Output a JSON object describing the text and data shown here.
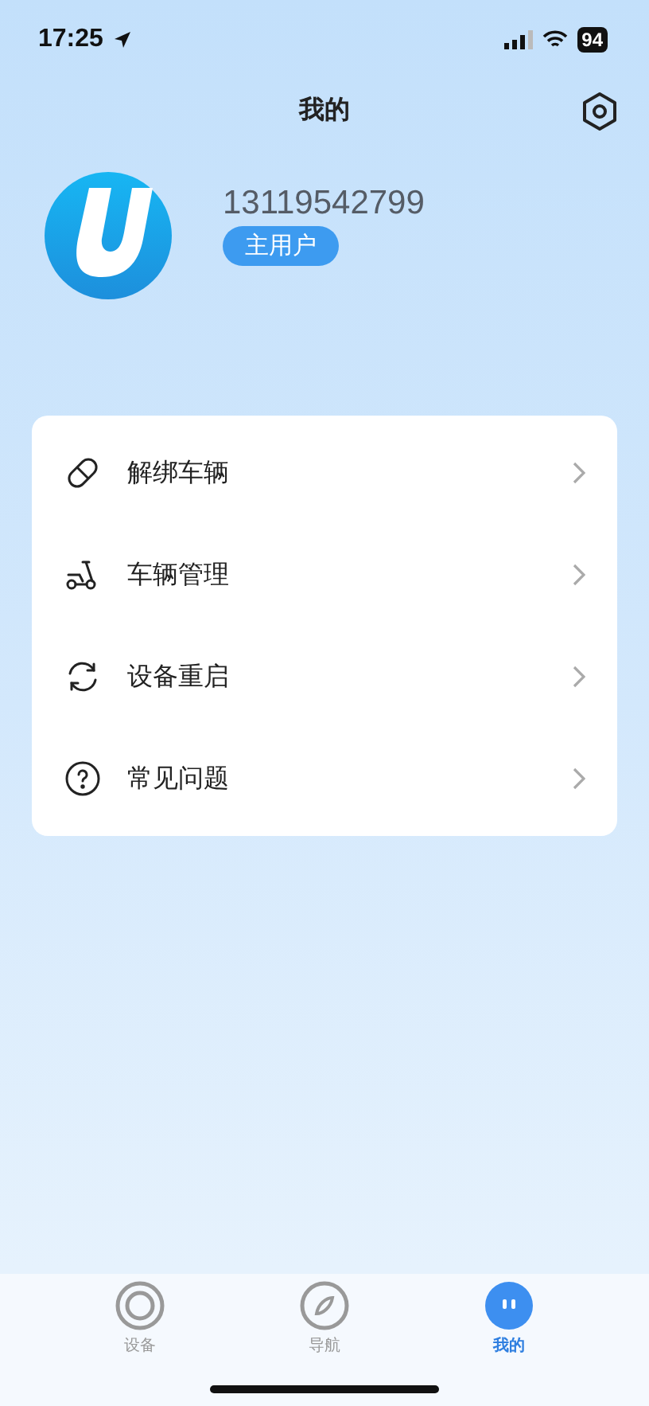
{
  "status_bar": {
    "time": "17:25",
    "battery": "94"
  },
  "header": {
    "title": "我的"
  },
  "profile": {
    "phone": "13119542799",
    "role": "主用户"
  },
  "menu": [
    {
      "kind": "unbind",
      "label": "解绑车辆"
    },
    {
      "kind": "scooter",
      "label": "车辆管理"
    },
    {
      "kind": "restart",
      "label": "设备重启"
    },
    {
      "kind": "help",
      "label": "常见问题"
    }
  ],
  "tabs": [
    {
      "kind": "device",
      "label": "设备",
      "selected": false
    },
    {
      "kind": "nav",
      "label": "导航",
      "selected": false
    },
    {
      "kind": "me",
      "label": "我的",
      "selected": true
    }
  ]
}
